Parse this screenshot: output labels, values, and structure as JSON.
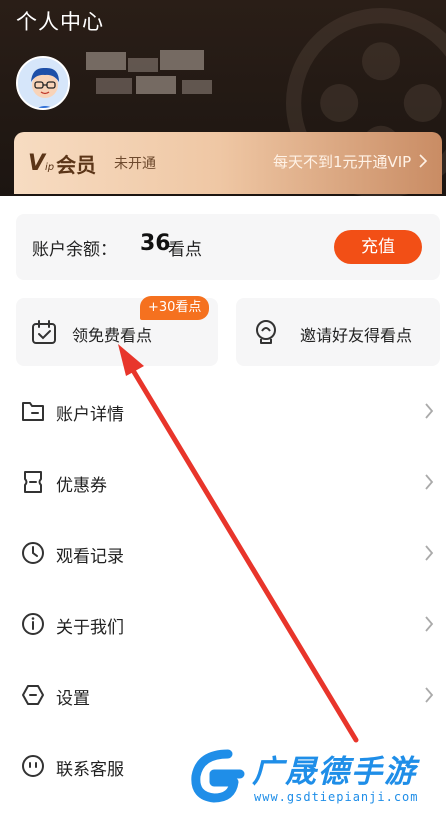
{
  "header": {
    "title": "个人中心"
  },
  "vip": {
    "logo_v": "V",
    "logo_ip": "ip",
    "logo_text": "会员",
    "status": "未开通",
    "promo": "每天不到1元开通VIP"
  },
  "balance": {
    "label": "账户余额：",
    "value": "36",
    "unit": "看点",
    "recharge_label": "充值"
  },
  "tasks": [
    {
      "label": "领免费看点",
      "badge": "+30看点"
    },
    {
      "label": "邀请好友得看点"
    }
  ],
  "menu": {
    "items": [
      {
        "label": "账户详情"
      },
      {
        "label": "优惠券"
      },
      {
        "label": "观看记录"
      },
      {
        "label": "关于我们"
      },
      {
        "label": "设置"
      },
      {
        "label": "联系客服"
      }
    ]
  },
  "watermark": {
    "title": "广晟德手游",
    "url": "www.gsdtiepianji.com"
  },
  "colors": {
    "accent": "#f24f16",
    "badge": "#f5711f",
    "annotation_arrow": "#e8352b",
    "watermark": "#1f8ee8"
  }
}
